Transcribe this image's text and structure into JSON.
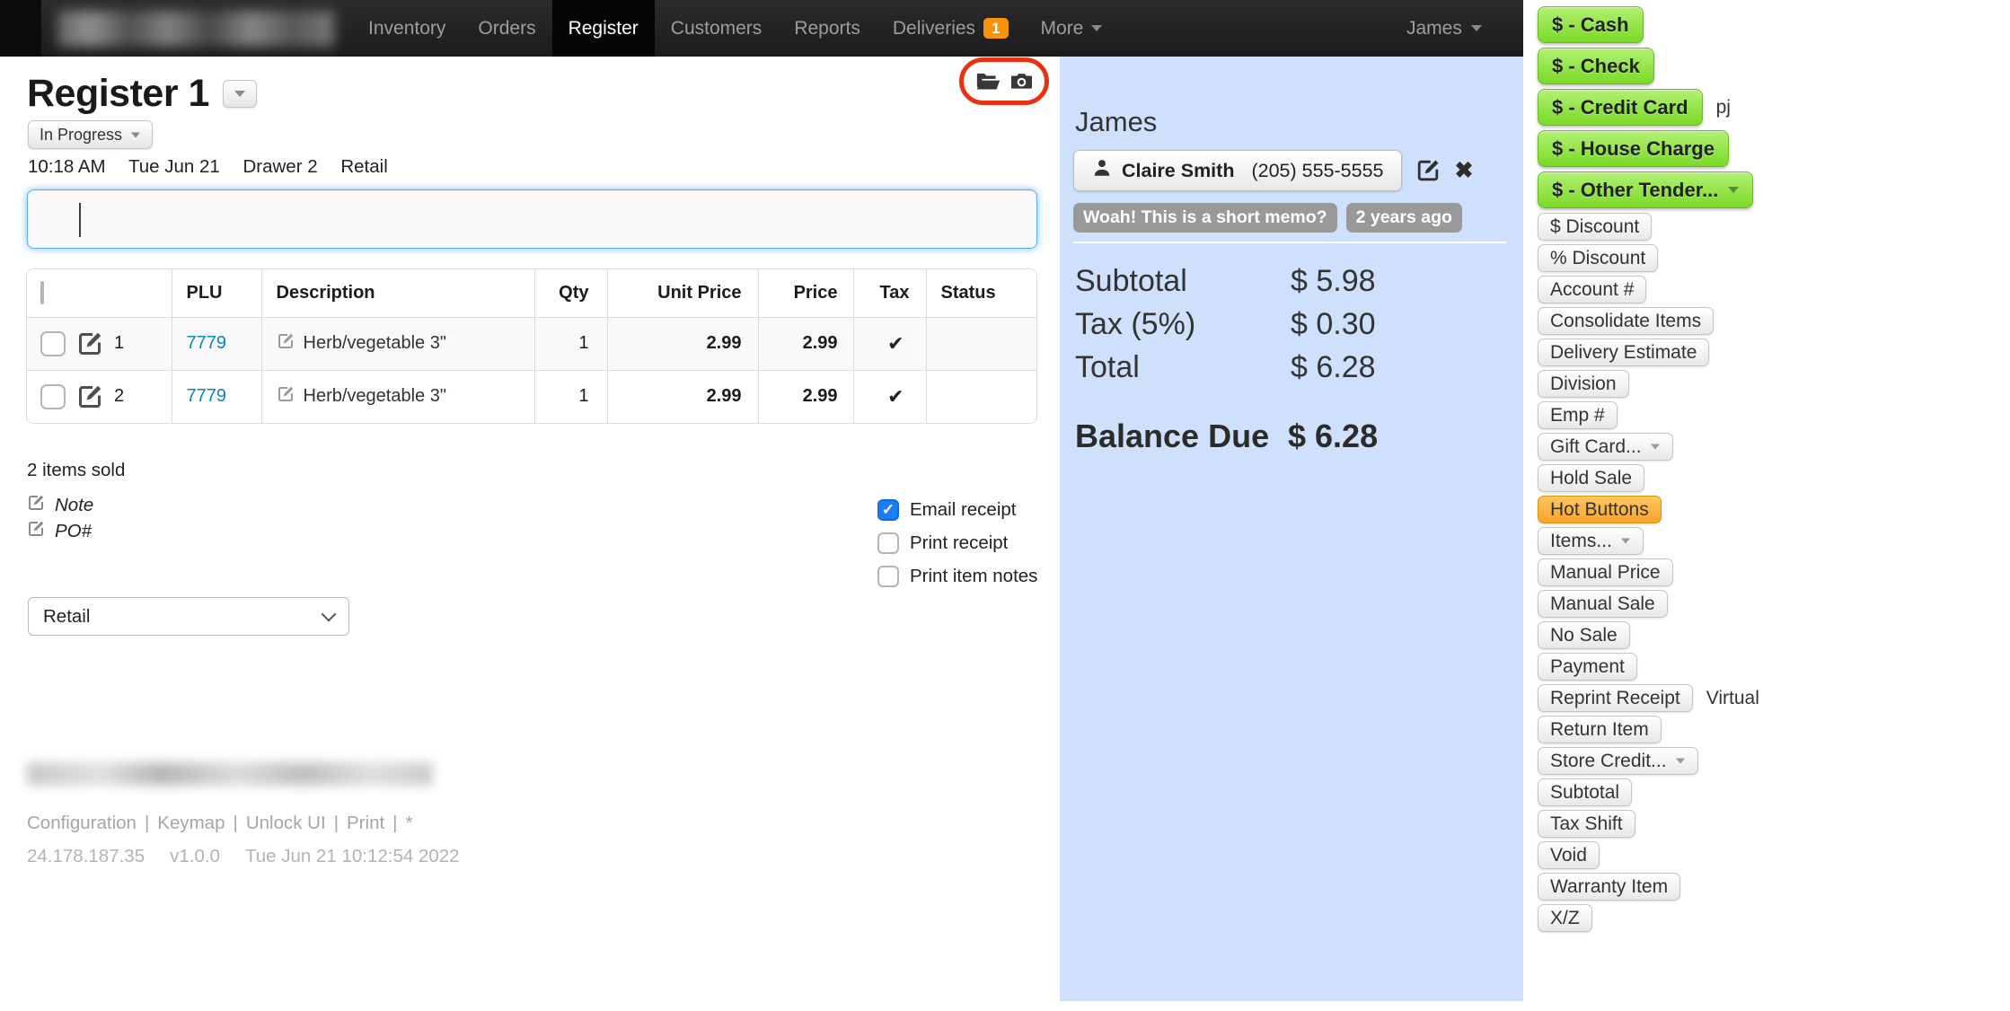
{
  "navbar": {
    "items": [
      {
        "label": "Inventory"
      },
      {
        "label": "Orders"
      },
      {
        "label": "Register"
      },
      {
        "label": "Customers"
      },
      {
        "label": "Reports"
      },
      {
        "label": "Deliveries",
        "badge": "1"
      },
      {
        "label": "More"
      }
    ],
    "user": "James",
    "badge_color": "#f89406"
  },
  "register": {
    "title": "Register 1",
    "status": "In Progress",
    "time": "10:18 AM",
    "date": "Tue Jun 21",
    "drawer": "Drawer 2",
    "mode": "Retail",
    "scan_input_value": ""
  },
  "items_table": {
    "headers": {
      "plu": "PLU",
      "description": "Description",
      "qty": "Qty",
      "unit_price": "Unit Price",
      "price": "Price",
      "tax": "Tax",
      "status": "Status"
    },
    "rows": [
      {
        "num": "1",
        "plu": "7779",
        "description": "Herb/vegetable 3\"",
        "qty": "1",
        "unit_price": "2.99",
        "price": "2.99",
        "tax": "✔",
        "status": ""
      },
      {
        "num": "2",
        "plu": "7779",
        "description": "Herb/vegetable 3\"",
        "qty": "1",
        "unit_price": "2.99",
        "price": "2.99",
        "tax": "✔",
        "status": ""
      }
    ],
    "summary": "2 items sold"
  },
  "sale_meta": {
    "note_label": "Note",
    "po_label": "PO#",
    "sale_type": "Retail"
  },
  "receipt_options": [
    {
      "label": "Email receipt",
      "checked": true
    },
    {
      "label": "Print receipt",
      "checked": false
    },
    {
      "label": "Print item notes",
      "checked": false
    }
  ],
  "footer": {
    "links": [
      "Configuration",
      "Keymap",
      "Unlock UI",
      "Print",
      "*"
    ],
    "separator": "|",
    "ip": "24.178.187.35",
    "version": "v1.0.0",
    "timestamp": "Tue Jun 21 10:12:54 2022"
  },
  "payment_panel": {
    "clerk": "James",
    "customer": {
      "name": "Claire Smith",
      "phone": "(205) 555-5555"
    },
    "memo": {
      "text": "Woah! This is a short memo?",
      "age": "2 years ago"
    },
    "totals": [
      {
        "label": "Subtotal",
        "value": "$ 5.98"
      },
      {
        "label": "Tax (5%)",
        "value": "$ 0.30"
      },
      {
        "label": "Total",
        "value": "$ 6.28"
      }
    ],
    "balance": {
      "label": "Balance Due",
      "value": "$ 6.28"
    },
    "panel_color": "#cee0fb"
  },
  "hot_buttons": {
    "tender_color": "#8ee04a",
    "highlight_color": "#fbb450",
    "tenders": [
      {
        "label": "$ - Cash"
      },
      {
        "label": "$ - Check"
      },
      {
        "label": "$ - Credit Card",
        "suffix": "pj"
      },
      {
        "label": "$ - House Charge"
      },
      {
        "label": "$ - Other Tender..."
      }
    ],
    "actions": [
      {
        "label": "$ Discount"
      },
      {
        "label": "% Discount"
      },
      {
        "label": "Account #"
      },
      {
        "label": "Consolidate Items"
      },
      {
        "label": "Delivery Estimate"
      },
      {
        "label": "Division"
      },
      {
        "label": "Emp #"
      },
      {
        "label": "Gift Card..."
      },
      {
        "label": "Hold Sale"
      },
      {
        "label": "Hot Buttons"
      },
      {
        "label": "Items..."
      },
      {
        "label": "Manual Price"
      },
      {
        "label": "Manual Sale"
      },
      {
        "label": "No Sale"
      },
      {
        "label": "Payment"
      },
      {
        "label": "Reprint Receipt",
        "suffix": "Virtual"
      },
      {
        "label": "Return Item"
      },
      {
        "label": "Store Credit..."
      },
      {
        "label": "Subtotal"
      },
      {
        "label": "Tax Shift"
      },
      {
        "label": "Void"
      },
      {
        "label": "Warranty Item"
      },
      {
        "label": "X/Z"
      }
    ],
    "icons": {
      "check": "✓",
      "close": "✖"
    }
  },
  "icons": {
    "check": "✓",
    "close": "✖"
  }
}
